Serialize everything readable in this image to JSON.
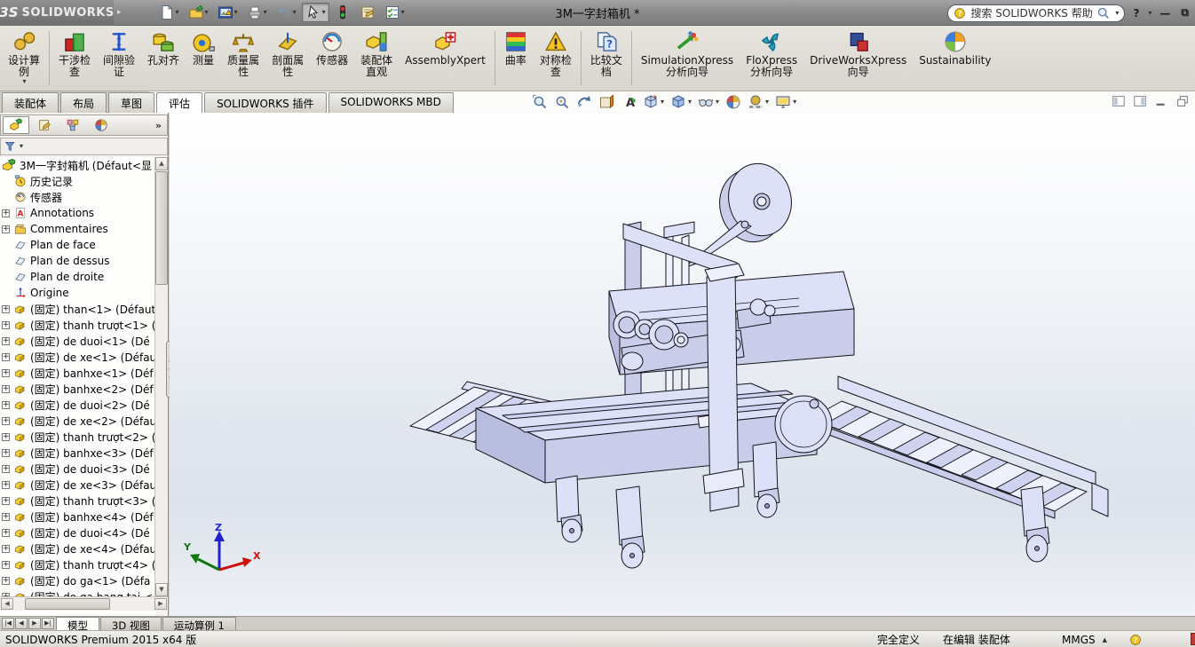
{
  "window": {
    "app_mark": "3S",
    "app_brand": "SOLIDWORKS",
    "document_title": "3M一字封箱机 *"
  },
  "search": {
    "placeholder": "搜索 SOLIDWORKS 帮助"
  },
  "colors": {
    "model_fill": "#dde1f8",
    "model_fill_dark": "#c9cdea",
    "model_edge": "#14141c",
    "titlebar_gray": "#8b8b8b",
    "viewport_mid": "#e2e7ef"
  },
  "title_toolbar": [
    {
      "icon": "new-document-icon",
      "dropdown": true
    },
    {
      "icon": "open-icon",
      "dropdown": true
    },
    {
      "icon": "publish-image-icon",
      "dropdown": true
    },
    {
      "icon": "print-icon",
      "dropdown": true
    },
    {
      "icon": "undo-icon",
      "dropdown": true
    },
    {
      "icon": "select-icon",
      "dropdown": true,
      "pressed": true
    },
    {
      "icon": "rebuild-icon"
    },
    {
      "icon": "file-properties-icon"
    },
    {
      "icon": "options-icon",
      "dropdown": true
    }
  ],
  "ribbon": {
    "items": [
      {
        "id": "design-study",
        "icon": "design-study-icon",
        "label": "设计算\n例",
        "dropdown": true
      },
      {
        "sep": true
      },
      {
        "id": "interference-check",
        "icon": "interference-icon",
        "label": "干涉检\n查"
      },
      {
        "id": "clearance-verify",
        "icon": "clearance-icon",
        "label": "间隙验\n证"
      },
      {
        "id": "hole-align",
        "icon": "hole-align-icon",
        "label": "孔对齐"
      },
      {
        "id": "measure",
        "icon": "measure-icon",
        "label": "测量"
      },
      {
        "id": "mass-properties",
        "icon": "mass-props-icon",
        "label": "质量属\n性"
      },
      {
        "id": "section-properties",
        "icon": "section-props-icon",
        "label": "剖面属\n性"
      },
      {
        "id": "sensors",
        "icon": "sensor-icon",
        "label": "传感器"
      },
      {
        "id": "assembly-visualization",
        "icon": "assembly-visual-icon",
        "label": "装配体\n直观"
      },
      {
        "id": "assemblyxpert",
        "icon": "assemblyxpert-icon",
        "label": "AssemblyXpert"
      },
      {
        "sep": true
      },
      {
        "id": "curvature",
        "icon": "curvature-icon",
        "label": "曲率"
      },
      {
        "id": "symmetry-check",
        "icon": "symmetry-icon",
        "label": "对称检\n查"
      },
      {
        "sep": true
      },
      {
        "id": "compare-documents",
        "icon": "compare-icon",
        "label": "比较文\n档"
      },
      {
        "sep": true
      },
      {
        "id": "simulationxpress",
        "icon": "simulationxpress-icon",
        "label": "SimulationXpress\n分析向导"
      },
      {
        "id": "floxpress",
        "icon": "floxpress-icon",
        "label": "FloXpress\n分析向导"
      },
      {
        "id": "driveworksxpress",
        "icon": "driveworksxpress-icon",
        "label": "DriveWorksXpress\n向导"
      },
      {
        "id": "sustainability",
        "icon": "sustainability-icon",
        "label": "Sustainability"
      }
    ]
  },
  "command_tabs": [
    {
      "label": "装配体"
    },
    {
      "label": "布局"
    },
    {
      "label": "草图"
    },
    {
      "label": "评估",
      "active": true
    },
    {
      "label": "SOLIDWORKS 插件"
    },
    {
      "label": "SOLIDWORKS MBD"
    }
  ],
  "view_toolbar": [
    {
      "icon": "zoom-fit-icon"
    },
    {
      "icon": "zoom-area-icon"
    },
    {
      "icon": "previous-view-icon"
    },
    {
      "icon": "section-view-icon"
    },
    {
      "icon": "annotation-view-icon"
    },
    {
      "icon": "view-orientation-icon",
      "dropdown": true
    },
    {
      "icon": "display-style-icon",
      "dropdown": true
    },
    {
      "icon": "hide-show-icon",
      "dropdown": true
    },
    {
      "icon": "appearance-icon"
    },
    {
      "icon": "scene-icon",
      "dropdown": true
    },
    {
      "icon": "view-settings-icon",
      "dropdown": true
    }
  ],
  "doc_window_buttons": [
    {
      "icon": "pane-left-icon"
    },
    {
      "icon": "pane-right-icon"
    },
    {
      "icon": "doc-minimize-icon"
    },
    {
      "icon": "doc-restore-icon"
    }
  ],
  "feature_panel": {
    "tabs": [
      {
        "icon": "featuretree-tab-icon",
        "active": true
      },
      {
        "icon": "property-tab-icon"
      },
      {
        "icon": "configuration-tab-icon"
      },
      {
        "icon": "display-tab-icon"
      }
    ],
    "overflow_chevron": "»",
    "tree": [
      {
        "icon": "assembly-icon",
        "label": "3M一字封箱机  (Défaut<显",
        "root": true
      },
      {
        "icon": "history-icon",
        "label": "历史记录"
      },
      {
        "icon": "sensors-icon",
        "label": "传感器"
      },
      {
        "icon": "annotations-icon",
        "label": "Annotations",
        "expand": true
      },
      {
        "icon": "comments-icon",
        "label": "Commentaires",
        "expand": true
      },
      {
        "icon": "plane-icon",
        "label": "Plan de face"
      },
      {
        "icon": "plane-icon",
        "label": "Plan de dessus"
      },
      {
        "icon": "plane-icon",
        "label": "Plan de droite"
      },
      {
        "icon": "origin-icon",
        "label": "Origine"
      },
      {
        "icon": "part-icon",
        "label": "(固定) than<1> (Défaut",
        "expand": true
      },
      {
        "icon": "part-icon",
        "label": "(固定) thanh trượt<1> (",
        "expand": true
      },
      {
        "icon": "part-icon",
        "label": "(固定) de duoi<1> (Dé",
        "expand": true
      },
      {
        "icon": "part-icon",
        "label": "(固定) de xe<1> (Défau",
        "expand": true
      },
      {
        "icon": "part-icon",
        "label": "(固定) banhxe<1> (Déf",
        "expand": true
      },
      {
        "icon": "part-icon",
        "label": "(固定) banhxe<2> (Déf",
        "expand": true
      },
      {
        "icon": "part-icon",
        "label": "(固定) de duoi<2> (Dé",
        "expand": true
      },
      {
        "icon": "part-icon",
        "label": "(固定) de xe<2> (Défau",
        "expand": true
      },
      {
        "icon": "part-icon",
        "label": "(固定) thanh trượt<2> (",
        "expand": true
      },
      {
        "icon": "part-icon",
        "label": "(固定) banhxe<3> (Déf",
        "expand": true
      },
      {
        "icon": "part-icon",
        "label": "(固定) de duoi<3> (Dé",
        "expand": true
      },
      {
        "icon": "part-icon",
        "label": "(固定) de xe<3> (Défau",
        "expand": true
      },
      {
        "icon": "part-icon",
        "label": "(固定) thanh trượt<3> (",
        "expand": true
      },
      {
        "icon": "part-icon",
        "label": "(固定) banhxe<4> (Déf",
        "expand": true
      },
      {
        "icon": "part-icon",
        "label": "(固定) de duoi<4> (Dé",
        "expand": true
      },
      {
        "icon": "part-icon",
        "label": "(固定) de xe<4> (Défau",
        "expand": true
      },
      {
        "icon": "part-icon",
        "label": "(固定) thanh trượt<4> (",
        "expand": true
      },
      {
        "icon": "part-icon",
        "label": "(固定) do ga<1> (Défa",
        "expand": true
      },
      {
        "icon": "part-icon",
        "label": "(固定) do ga bang tai <",
        "expand": true
      }
    ]
  },
  "triad": {
    "x_label": "X",
    "y_label": "Y",
    "z_label": "Z",
    "x_color": "#cc1111",
    "y_color": "#117711",
    "z_color": "#2222cc"
  },
  "bottom": {
    "nav_buttons": [
      "|◀",
      "◀",
      "▶",
      "▶|"
    ],
    "tabs": [
      {
        "label": "模型",
        "active": true
      },
      {
        "label": "3D 视图"
      },
      {
        "label": "运动算例 1"
      }
    ]
  },
  "status": {
    "left": "SOLIDWORKS Premium 2015 x64 版",
    "defined": "完全定义",
    "editing": "在编辑 装配体",
    "unit": "MMGS"
  }
}
